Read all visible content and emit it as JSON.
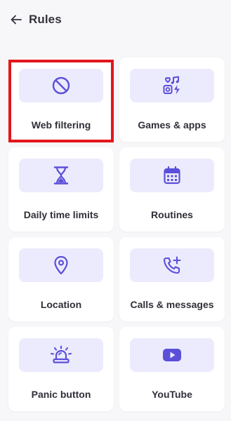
{
  "header": {
    "title": "Rules",
    "back_icon": "arrow-left-icon"
  },
  "accent_color": "#5b4fd9",
  "tile_color": "#ecebfd",
  "highlight_color": "#e3161b",
  "rules": [
    {
      "label": "Web filtering",
      "icon": "block-icon",
      "selected": true
    },
    {
      "label": "Games & apps",
      "icon": "games-apps-icon",
      "selected": false
    },
    {
      "label": "Daily time limits",
      "icon": "hourglass-icon",
      "selected": false
    },
    {
      "label": "Routines",
      "icon": "calendar-icon",
      "selected": false
    },
    {
      "label": "Location",
      "icon": "location-pin-icon",
      "selected": false
    },
    {
      "label": "Calls & messages",
      "icon": "phone-plus-icon",
      "selected": false
    },
    {
      "label": "Panic button",
      "icon": "siren-icon",
      "selected": false
    },
    {
      "label": "YouTube",
      "icon": "youtube-icon",
      "selected": false
    }
  ]
}
